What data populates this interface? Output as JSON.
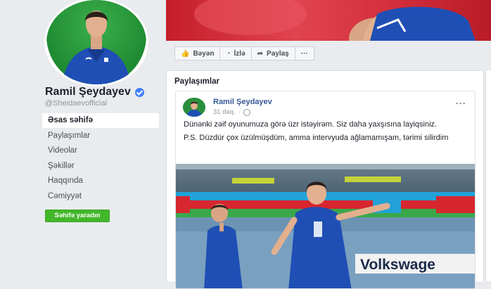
{
  "profile": {
    "name": "Ramil Şeydayev",
    "handle": "@Sheidaevofficial"
  },
  "nav": {
    "items": [
      {
        "label": "Əsas səhifə",
        "active": true
      },
      {
        "label": "Paylaşımlar",
        "active": false
      },
      {
        "label": "Videolar",
        "active": false
      },
      {
        "label": "Şəkillər",
        "active": false
      },
      {
        "label": "Haqqında",
        "active": false
      },
      {
        "label": "Cəmiyyət",
        "active": false
      }
    ],
    "create_page_label": "Səhifə yaradın"
  },
  "actions": {
    "like_label": "Bəyən",
    "follow_label": "İzlə",
    "share_label": "Paylaş",
    "more_label": "···"
  },
  "posts_section": {
    "title": "Paylaşımlar"
  },
  "post": {
    "author": "Ramil Şeydayev",
    "time": "31 dəq.",
    "dot": "·",
    "more": "···",
    "text_line1": "Dünənki zəif oyunumuza görə üzr istəyirəm. Siz daha yaxşısına layiqsiniz.",
    "text_line2": "P.S. Düzdür çox üzülmüşdüm, amma intervyuda ağlamamışam, tərimi silirdim",
    "ad_board_text": "Volkswage"
  },
  "colors": {
    "brand_blue": "#365899",
    "create_green": "#42b72a",
    "cover_red": "#c41e2a",
    "kit_blue": "#1f4fb5"
  }
}
